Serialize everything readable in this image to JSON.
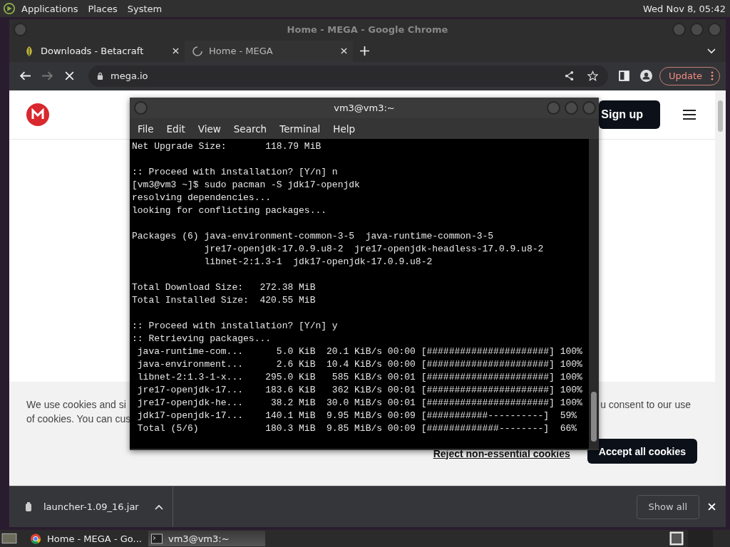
{
  "top_panel": {
    "menus": [
      "Applications",
      "Places",
      "System"
    ],
    "clock": "Wed Nov 8, 05:42"
  },
  "browser": {
    "title": "Home - MEGA - Google Chrome",
    "tabs": [
      {
        "title": "Downloads - Betacraft",
        "selected": false,
        "kind": "site"
      },
      {
        "title": "Home - MEGA",
        "selected": true,
        "kind": "loading"
      }
    ],
    "address": "mega.io",
    "update_button": "Update",
    "page": {
      "signup_button": "Sign up",
      "cookie_text_left": [
        "We use cookies and si",
        "of cookies. You can cus"
      ],
      "cookie_text_right": "u consent to our use",
      "reject_link": "Reject non-essential cookies",
      "accept_button": "Accept all cookies"
    },
    "download": {
      "file": "launcher-1.09_16.jar",
      "show_all": "Show all"
    }
  },
  "terminal": {
    "title": "vm3@vm3:~",
    "menus": [
      "File",
      "Edit",
      "View",
      "Search",
      "Terminal",
      "Help"
    ],
    "blocks": [
      [
        "Net Upgrade Size:       118.79 MiB"
      ],
      [
        ":: Proceed with installation? [Y/n] n",
        "[vm3@vm3 ~]$ sudo pacman -S jdk17-openjdk",
        "resolving dependencies...",
        "looking for conflicting packages..."
      ],
      [
        "Packages (6) java-environment-common-3-5  java-runtime-common-3-5",
        "             jre17-openjdk-17.0.9.u8-2  jre17-openjdk-headless-17.0.9.u8-2",
        "             libnet-2:1.3-1  jdk17-openjdk-17.0.9.u8-2"
      ],
      [
        "Total Download Size:   272.38 MiB",
        "Total Installed Size:  420.55 MiB"
      ],
      [
        ":: Proceed with installation? [Y/n] y",
        ":: Retrieving packages...",
        " java-runtime-com...      5.0 KiB  20.1 KiB/s 00:00 [######################] 100%",
        " java-environment...      2.6 KiB  10.4 KiB/s 00:00 [######################] 100%",
        " libnet-2:1.3-1-x...    295.0 KiB   585 KiB/s 00:01 [######################] 100%",
        " jre17-openjdk-17...    183.6 KiB   362 KiB/s 00:01 [######################] 100%",
        " jre17-openjdk-he...     38.2 MiB  30.0 MiB/s 00:01 [######################] 100%",
        " jdk17-openjdk-17...    140.1 MiB  9.95 MiB/s 00:09 [###########----------]  59%",
        " Total (5/6)            180.3 MiB  9.85 MiB/s 00:09 [#############--------]  66%"
      ]
    ]
  },
  "taskbar": {
    "items": [
      {
        "label": "Home - MEGA - Go...",
        "selected": false,
        "kind": "browser"
      },
      {
        "label": "vm3@vm3:~",
        "selected": true,
        "kind": "terminal"
      }
    ]
  }
}
